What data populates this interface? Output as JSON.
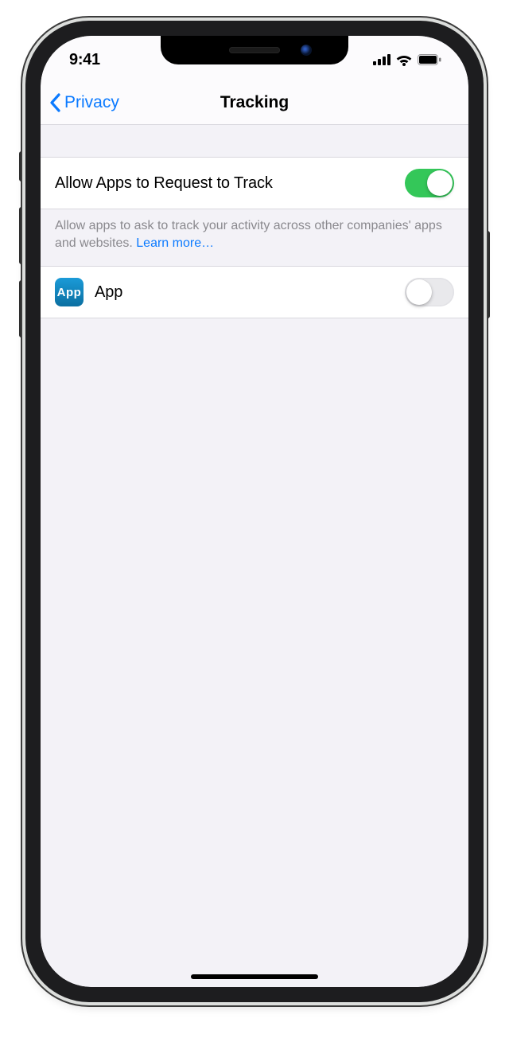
{
  "status": {
    "time": "9:41"
  },
  "nav": {
    "back_label": "Privacy",
    "title": "Tracking"
  },
  "tracking": {
    "allow_label": "Allow Apps to Request to Track",
    "allow_enabled": true,
    "footer_text": "Allow apps to ask to track your activity across other companies' apps and websites. ",
    "learn_more": "Learn more…"
  },
  "apps": [
    {
      "icon_text": "App",
      "name": "App",
      "tracking_enabled": false
    }
  ],
  "colors": {
    "accent_blue": "#0b7aff",
    "switch_on": "#34c759"
  }
}
